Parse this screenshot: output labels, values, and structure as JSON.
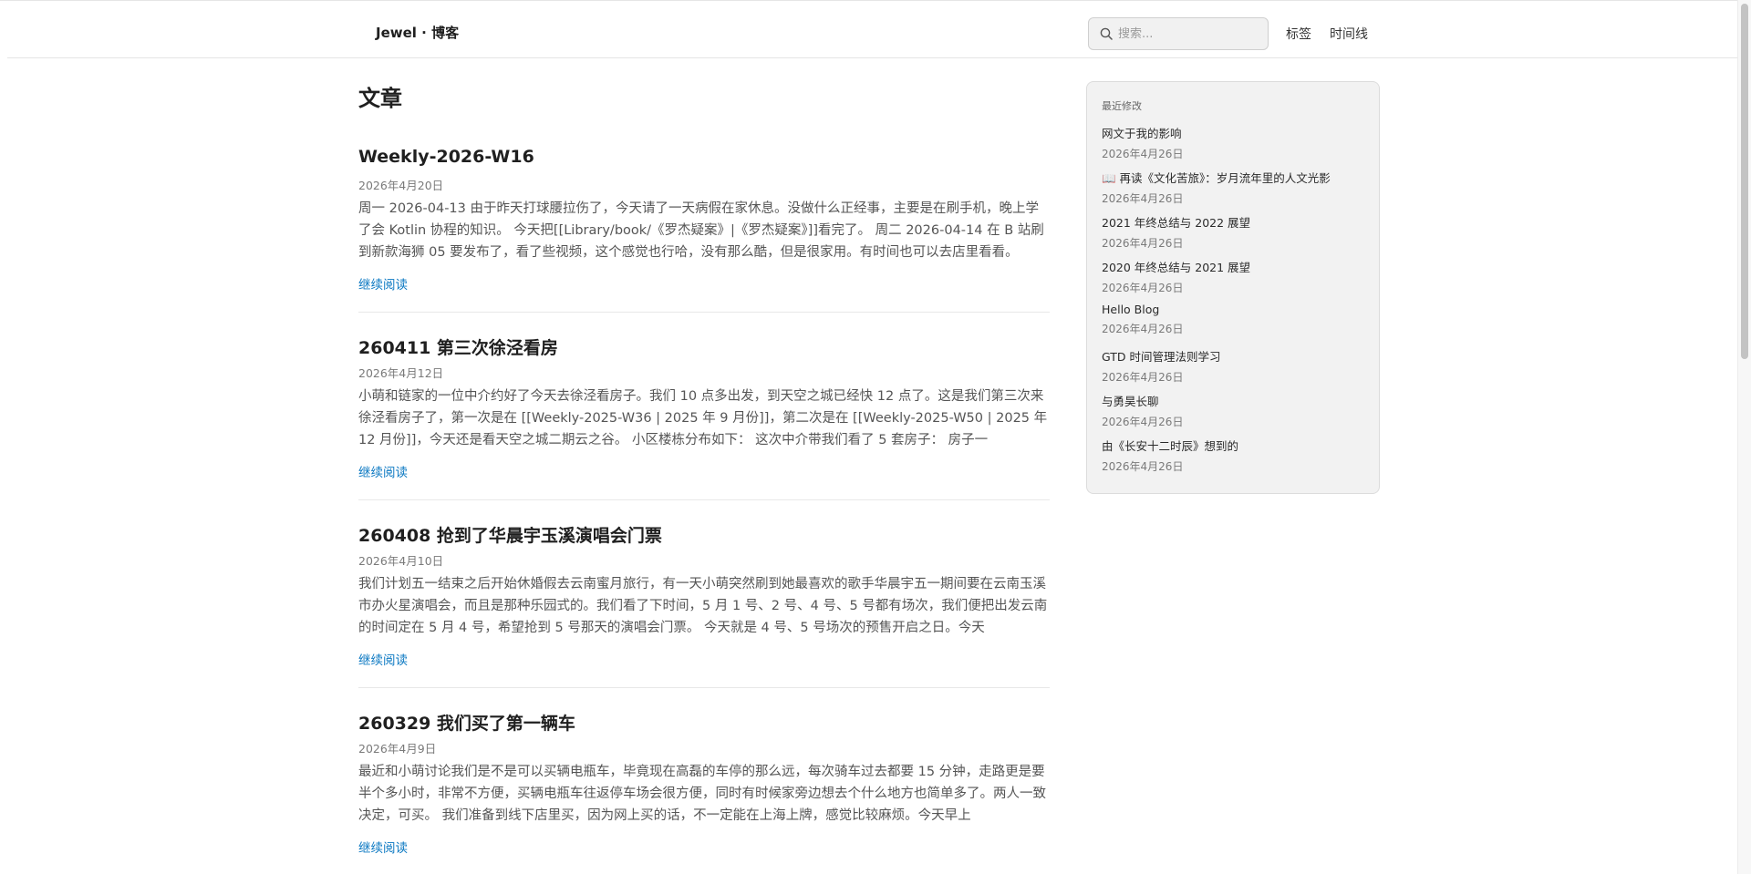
{
  "header": {
    "brand": "Jewel · 博客",
    "search_placeholder": "搜索...",
    "nav": [
      "标签",
      "时间线"
    ]
  },
  "main": {
    "title": "文章",
    "more_label": "继续阅读",
    "articles": [
      {
        "title": "Weekly-2026-W16",
        "date": "2026年4月20日",
        "excerpt": "周一 2026-04-13 由于昨天打球腰拉伤了，今天请了一天病假在家休息。没做什么正经事，主要是在刷手机，晚上学了会 Kotlin 协程的知识。 今天把[[Library/book/《罗杰疑案》|《罗杰疑案》]]看完了。 周二 2026-04-14 在 B 站刷到新款海狮 05 要发布了，看了些视频，这个感觉也行哈，没有那么酷，但是很家用。有时间也可以去店里看看。"
      },
      {
        "title": "260411 第三次徐泾看房",
        "date": "2026年4月12日",
        "excerpt": "小萌和链家的一位中介约好了今天去徐泾看房子。我们 10 点多出发，到天空之城已经快 12 点了。这是我们第三次来徐泾看房子了，第一次是在 [[Weekly-2025-W36 | 2025 年 9 月份]]，第二次是在 [[Weekly-2025-W50 | 2025 年 12 月份]]，今天还是看天空之城二期云之谷。 小区楼栋分布如下： 这次中介带我们看了 5 套房子： 房子一"
      },
      {
        "title": "260408 抢到了华晨宇玉溪演唱会门票",
        "date": "2026年4月10日",
        "excerpt": "我们计划五一结束之后开始休婚假去云南蜜月旅行，有一天小萌突然刷到她最喜欢的歌手华晨宇五一期间要在云南玉溪市办火星演唱会，而且是那种乐园式的。我们看了下时间，5 月 1 号、2 号、4 号、5 号都有场次，我们便把出发云南的时间定在 5 月 4 号，希望抢到 5 号那天的演唱会门票。 今天就是 4 号、5 号场次的预售开启之日。今天"
      },
      {
        "title": "260329 我们买了第一辆车",
        "date": "2026年4月9日",
        "excerpt": "最近和小萌讨论我们是不是可以买辆电瓶车，毕竟现在高磊的车停的那么远，每次骑车过去都要 15 分钟，走路更是要半个多小时，非常不方便，买辆电瓶车往返停车场会很方便，同时有时候家旁边想去个什么地方也简单多了。两人一致决定，可买。 我们准备到线下店里买，因为网上买的话，不一定能在上海上牌，感觉比较麻烦。今天早上"
      }
    ]
  },
  "sidebar": {
    "heading": "最近修改",
    "items": [
      {
        "title": "网文于我的影响",
        "date": "2026年4月26日"
      },
      {
        "title": "📖 再读《文化苦旅》：岁月流年里的人文光影",
        "date": "2026年4月26日"
      },
      {
        "title": "2021 年终总结与 2022 展望",
        "date": "2026年4月26日"
      },
      {
        "title": "2020 年终总结与 2021 展望",
        "date": "2026年4月26日"
      },
      {
        "title": "Hello Blog",
        "date": "2026年4月26日"
      },
      {
        "title": "GTD 时间管理法则学习",
        "date": "2026年4月26日"
      },
      {
        "title": "与勇昊长聊",
        "date": "2026年4月26日"
      },
      {
        "title": "由《长安十二时辰》想到的",
        "date": "2026年4月26日"
      }
    ]
  }
}
